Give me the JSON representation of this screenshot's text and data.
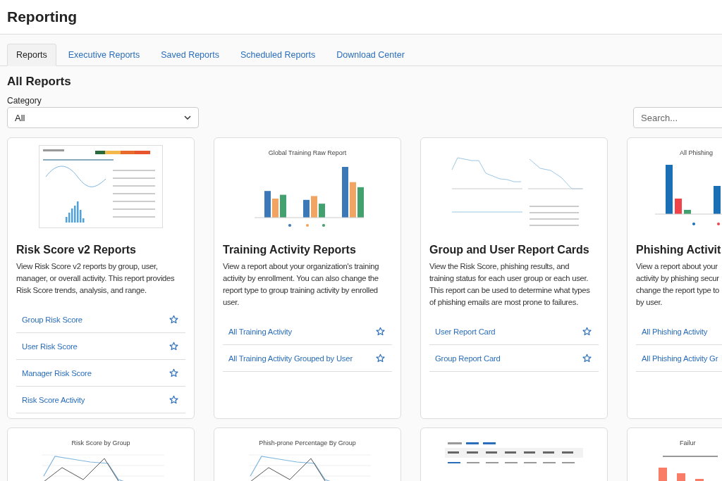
{
  "page_title": "Reporting",
  "tabs": [
    {
      "label": "Reports",
      "selected": true
    },
    {
      "label": "Executive Reports",
      "selected": false
    },
    {
      "label": "Saved Reports",
      "selected": false
    },
    {
      "label": "Scheduled Reports",
      "selected": false
    },
    {
      "label": "Download Center",
      "selected": false
    }
  ],
  "section_title": "All Reports",
  "category": {
    "label": "Category",
    "value": "All"
  },
  "search": {
    "placeholder": "Search..."
  },
  "cards": [
    {
      "preview": {
        "kind": "dashboard"
      },
      "title": "Risk Score v2 Reports",
      "description_lines": [
        "View Risk Score v2 reports by group, user,",
        "manager, or overall activity. This report provides",
        "Risk Score trends, analysis, and range."
      ],
      "links": [
        "Group Risk Score",
        "User Risk Score",
        "Manager Risk Score",
        "Risk Score Activity"
      ]
    },
    {
      "preview": {
        "kind": "grouped-bar",
        "title": "Global Training Raw Report"
      },
      "title": "Training Activity Reports",
      "description_lines": [
        "View a report about your organization's training",
        "activity by enrollment. You can also change the",
        "report type to group training activity by enrolled",
        "user."
      ],
      "links": [
        "All Training Activity",
        "All Training Activity Grouped by User"
      ]
    },
    {
      "preview": {
        "kind": "line-panels"
      },
      "title": "Group and User Report Cards",
      "description_lines": [
        "View the Risk Score, phishing results, and",
        "training status for each user group or each user.",
        "This report can be used to determine what types",
        "of phishing emails are most prone to failures."
      ],
      "links": [
        "User Report Card",
        "Group Report Card"
      ]
    },
    {
      "preview": {
        "kind": "bar",
        "title": "All Phishing"
      },
      "title": "Phishing Activit",
      "description_lines": [
        "View a report about your",
        "activity by phishing secur",
        "change the report type to",
        "by user."
      ],
      "links": [
        "All Phishing Activity",
        "All Phishing Activity Gr"
      ]
    }
  ],
  "more_cards": [
    {
      "preview": {
        "kind": "line",
        "title": "Risk Score by Group"
      }
    },
    {
      "preview": {
        "kind": "line",
        "title": "Phish-prone Percentage By Group"
      }
    },
    {
      "preview": {
        "kind": "table"
      }
    },
    {
      "preview": {
        "kind": "bar-line",
        "title": "Failur"
      }
    }
  ]
}
